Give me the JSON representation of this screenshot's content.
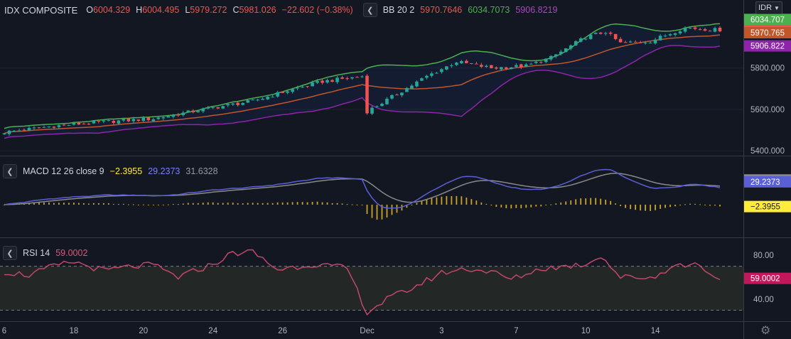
{
  "symbol": "IDX COMPOSITE",
  "ohlc": {
    "o_label": "O",
    "o": "6004.329",
    "h_label": "H",
    "h": "6004.495",
    "l_label": "L",
    "l": "5979.272",
    "c_label": "C",
    "c": "5981.026",
    "change": "−22.602 (−0.38%)"
  },
  "bb": {
    "label": "BB 20 2",
    "basis": "5970.7646",
    "upper": "6034.7073",
    "lower": "5906.8219"
  },
  "macd": {
    "label": "MACD 12 26 close 9",
    "hist": "−2.3955",
    "macd": "29.2373",
    "signal": "31.6328"
  },
  "rsi": {
    "label": "RSI 14",
    "value": "59.0002"
  },
  "currency": "IDR",
  "colors": {
    "bg": "#131722",
    "up": "#26a69a",
    "down": "#ef5350",
    "bb_upper": "#4caf50",
    "bb_basis": "#c2562b",
    "bb_lower": "#8e24aa",
    "macd": "#5b5fd6",
    "signal": "#8a8a8a",
    "hist": "#c9a227",
    "rsi": "#c2476a"
  },
  "icons": {
    "collapse": "chevron-left-icon",
    "settings": "gear-icon",
    "dropdown": "chevron-down-icon"
  },
  "chart_data": {
    "type": "candlestick",
    "price_axis": {
      "ticks": [
        "5400.000",
        "5600.000",
        "5800.000"
      ],
      "ylim": [
        5380,
        6060
      ],
      "price_labels": [
        {
          "text": "6034.707",
          "value": 6034.707,
          "color": "#4caf50"
        },
        {
          "text": "5981.026",
          "value": 5981.026,
          "color": "#ef5350"
        },
        {
          "text": "5970.765",
          "value": 5970.765,
          "color": "#c2562b"
        },
        {
          "text": "5906.822",
          "value": 5906.822,
          "color": "#8e24aa"
        }
      ]
    },
    "x_ticks": [
      "6",
      "18",
      "20",
      "24",
      "26",
      "Dec",
      "3",
      "7",
      "10",
      "14"
    ],
    "x_tick_bars": [
      0,
      14,
      28,
      42,
      56,
      73,
      88,
      103,
      117,
      131
    ],
    "bars": 145,
    "close_path": [
      [
        0,
        5490
      ],
      [
        10,
        5520
      ],
      [
        20,
        5540
      ],
      [
        30,
        5555
      ],
      [
        40,
        5600
      ],
      [
        50,
        5640
      ],
      [
        57,
        5690
      ],
      [
        64,
        5735
      ],
      [
        72,
        5760
      ],
      [
        73,
        5590
      ],
      [
        78,
        5660
      ],
      [
        85,
        5760
      ],
      [
        91,
        5830
      ],
      [
        98,
        5800
      ],
      [
        105,
        5810
      ],
      [
        110,
        5850
      ],
      [
        117,
        5950
      ],
      [
        121,
        5975
      ],
      [
        124,
        5920
      ],
      [
        130,
        5930
      ],
      [
        137,
        5995
      ],
      [
        143,
        5985
      ]
    ],
    "macd_axis": {
      "ylim": [
        -40,
        60
      ],
      "labels": [
        {
          "text": "31.6328",
          "value": 31.6328,
          "color": "#888888"
        },
        {
          "text": "29.2373",
          "value": 29.2373,
          "color": "#5b5fd6"
        },
        {
          "text": "−2.3955",
          "value": -2.3955,
          "color": "#ffeb3b"
        }
      ]
    },
    "rsi_axis": {
      "ylim": [
        20,
        95
      ],
      "ticks": [
        "40.00",
        "80.00"
      ],
      "value_label": "59.0002",
      "value": 59.0002,
      "bands": [
        30,
        70
      ]
    },
    "rsi_path": [
      [
        0,
        65
      ],
      [
        5,
        62
      ],
      [
        10,
        70
      ],
      [
        14,
        74
      ],
      [
        20,
        66
      ],
      [
        26,
        70
      ],
      [
        30,
        71
      ],
      [
        35,
        60
      ],
      [
        42,
        72
      ],
      [
        46,
        82
      ],
      [
        50,
        83
      ],
      [
        55,
        67
      ],
      [
        62,
        72
      ],
      [
        69,
        68
      ],
      [
        73,
        28
      ],
      [
        77,
        40
      ],
      [
        82,
        50
      ],
      [
        88,
        64
      ],
      [
        93,
        68
      ],
      [
        98,
        65
      ],
      [
        102,
        58
      ],
      [
        108,
        68
      ],
      [
        113,
        70
      ],
      [
        117,
        72
      ],
      [
        120,
        80
      ],
      [
        124,
        60
      ],
      [
        131,
        60
      ],
      [
        134,
        70
      ],
      [
        140,
        72
      ],
      [
        143,
        59
      ]
    ]
  }
}
